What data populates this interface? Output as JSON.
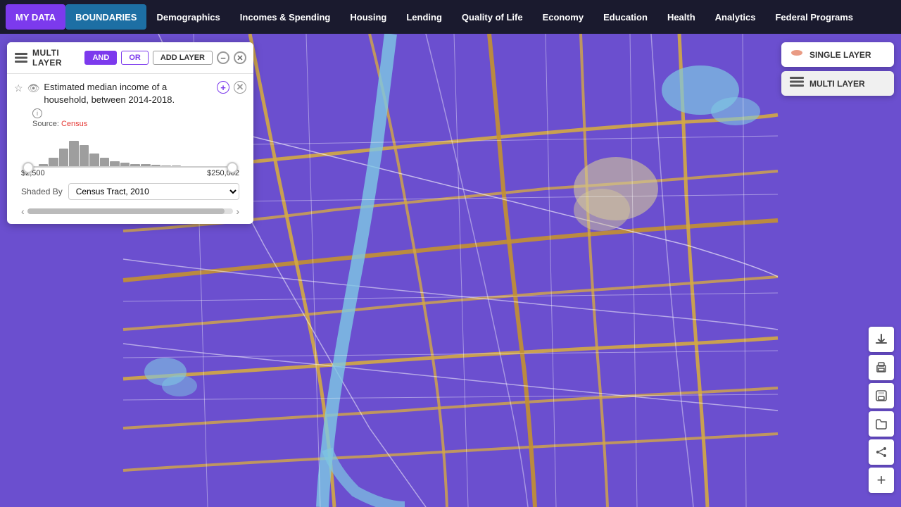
{
  "nav": {
    "items": [
      {
        "id": "my-data",
        "label": "MY DATA",
        "active": "purple"
      },
      {
        "id": "boundaries",
        "label": "BOUNDARIES",
        "active": "blue"
      },
      {
        "id": "demographics",
        "label": "Demographics",
        "active": false
      },
      {
        "id": "incomes-spending",
        "label": "Incomes & Spending",
        "active": false
      },
      {
        "id": "housing",
        "label": "Housing",
        "active": false
      },
      {
        "id": "lending",
        "label": "Lending",
        "active": false
      },
      {
        "id": "quality-of-life",
        "label": "Quality of Life",
        "active": false
      },
      {
        "id": "economy",
        "label": "Economy",
        "active": false
      },
      {
        "id": "education",
        "label": "Education",
        "active": false
      },
      {
        "id": "health",
        "label": "Health",
        "active": false
      },
      {
        "id": "analytics",
        "label": "Analytics",
        "active": false
      },
      {
        "id": "federal-programs",
        "label": "Federal Programs",
        "active": false
      }
    ]
  },
  "multi_layer": {
    "title": "MULTI LAYER",
    "and_label": "AND",
    "or_label": "OR",
    "add_layer_label": "ADD LAYER"
  },
  "layer": {
    "title": "Estimated median income of a household, between 2014-2018.",
    "source_prefix": "Source: ",
    "source_name": "Census",
    "min_value": "$2,500",
    "max_value": "$250,002",
    "shaded_by_label": "Shaded By",
    "shaded_by_value": "Census Tract, 2010"
  },
  "right_panel": {
    "single_layer_label": "SINGLE LAYER",
    "multi_layer_label": "MULTI LAYER"
  },
  "tools": {
    "download": "⬇",
    "print": "🖨",
    "save": "💾",
    "folder": "📁",
    "share": "↗",
    "zoom_plus": "+"
  },
  "histogram_bars": [
    2,
    5,
    15,
    30,
    42,
    35,
    22,
    15,
    10,
    8,
    6,
    5,
    4,
    3,
    3,
    2,
    2,
    2,
    1,
    1
  ]
}
